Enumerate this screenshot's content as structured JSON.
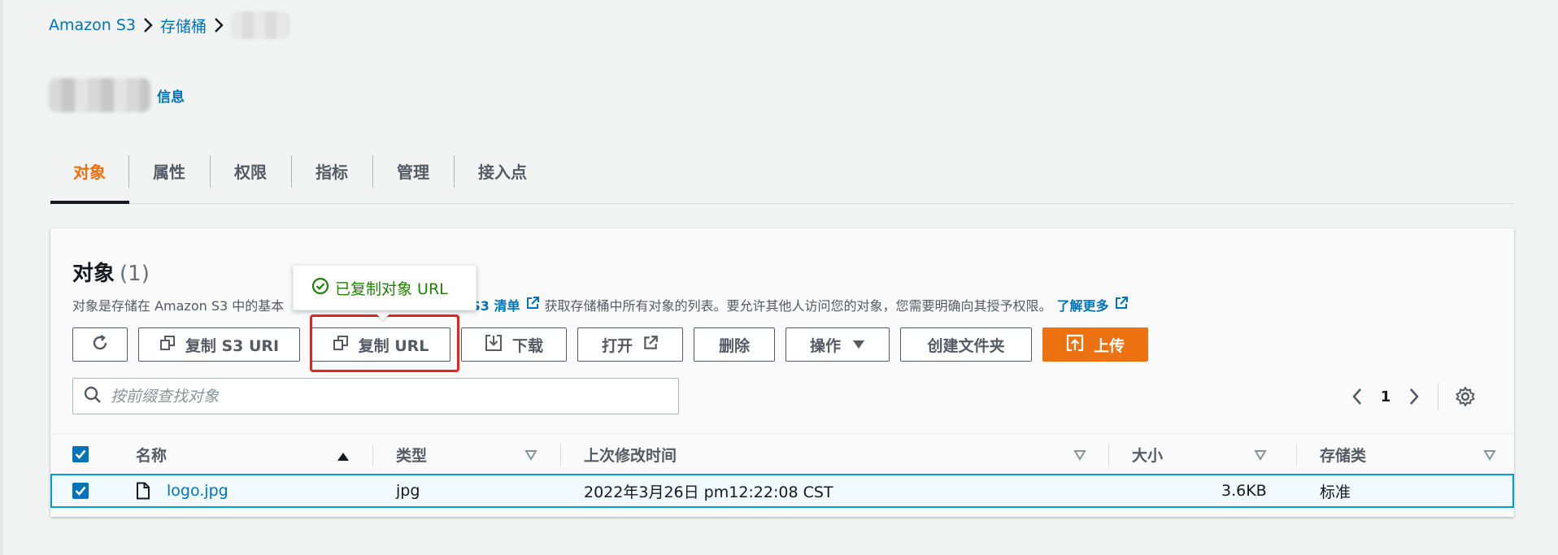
{
  "breadcrumb": {
    "root": "Amazon S3",
    "buckets": "存储桶"
  },
  "header": {
    "info_link": "信息"
  },
  "tabs": [
    {
      "label": "对象",
      "active": true
    },
    {
      "label": "属性"
    },
    {
      "label": "权限"
    },
    {
      "label": "指标"
    },
    {
      "label": "管理"
    },
    {
      "label": "接入点"
    }
  ],
  "objects_panel": {
    "title": "对象",
    "count": "(1)",
    "description_prefix": "对象是存储在 Amazon S3 中的基本",
    "description_link": "S3 清单",
    "description_middle": "获取存储桶中所有对象的列表。要允许其他人访问您的对象，您需要明确向其授予权限。",
    "learn_more": "了解更多"
  },
  "toolbar": {
    "copy_s3_uri": "复制 S3 URI",
    "copy_url": "复制 URL",
    "download": "下载",
    "open": "打开",
    "delete": "删除",
    "actions": "操作",
    "create_folder": "创建文件夹",
    "upload": "上传"
  },
  "tooltip": {
    "text": "已复制对象 URL",
    "color": "#1d8102"
  },
  "search": {
    "placeholder": "按前缀查找对象"
  },
  "pagination": {
    "current_page": "1"
  },
  "table": {
    "columns": [
      "名称",
      "类型",
      "上次修改时间",
      "大小",
      "存储类"
    ],
    "rows": [
      {
        "name": "logo.jpg",
        "type": "jpg",
        "last_modified": "2022年3月26日 pm12:22:08 CST",
        "size": "3.6KB",
        "storage_class": "标准",
        "selected": true
      }
    ]
  },
  "colors": {
    "accent": "#ec7211",
    "link": "#0073bb",
    "highlight": "#e8231f"
  }
}
